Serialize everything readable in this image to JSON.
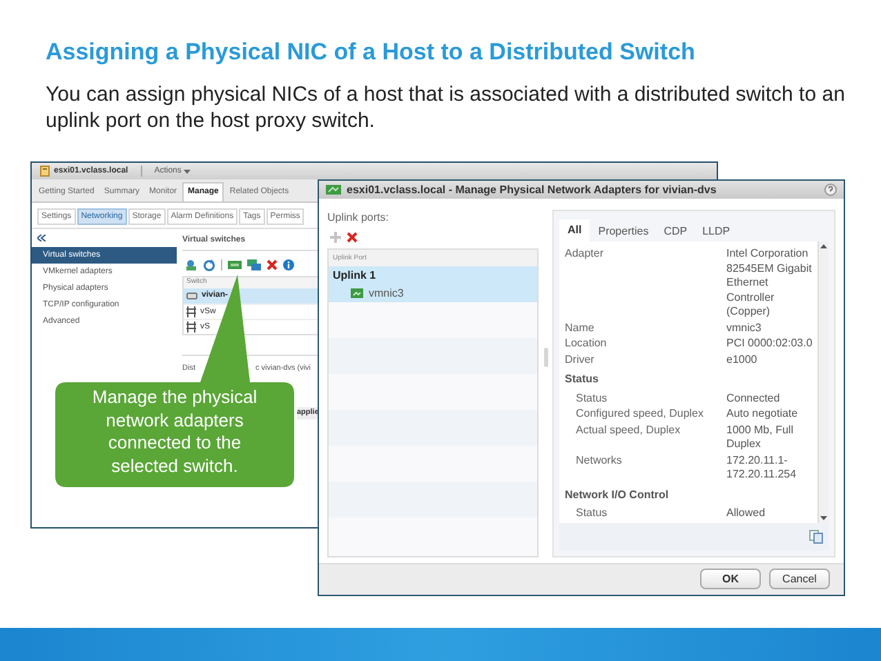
{
  "slide": {
    "title": "Assigning a Physical NIC of a Host to a Distributed Switch",
    "body": "You can assign physical NICs of a host that is associated with a distributed switch to an uplink port on the host proxy switch."
  },
  "host_window": {
    "title": "esxi01.vclass.local",
    "actions_menu": "Actions",
    "tabs": [
      {
        "label": "Getting Started",
        "selected": false
      },
      {
        "label": "Summary",
        "selected": false
      },
      {
        "label": "Monitor",
        "selected": false
      },
      {
        "label": "Manage",
        "selected": true
      },
      {
        "label": "Related Objects",
        "selected": false
      }
    ],
    "subtabs": [
      {
        "label": "Settings",
        "selected": false
      },
      {
        "label": "Networking",
        "selected": true
      },
      {
        "label": "Storage",
        "selected": false
      },
      {
        "label": "Alarm Definitions",
        "selected": false
      },
      {
        "label": "Tags",
        "selected": false
      },
      {
        "label": "Permiss",
        "selected": false
      }
    ],
    "nav_items": [
      {
        "label": "Virtual switches",
        "selected": true
      },
      {
        "label": "VMkernel adapters",
        "selected": false
      },
      {
        "label": "Physical adapters",
        "selected": false
      },
      {
        "label": "TCP/IP configuration",
        "selected": false
      },
      {
        "label": "Advanced",
        "selected": false
      }
    ],
    "switches": {
      "title": "Virtual switches",
      "column": "Switch",
      "rows": [
        {
          "name": "vivian-",
          "kind": "distributed",
          "selected": true
        },
        {
          "name": "vSw",
          "kind": "standard",
          "selected": false
        },
        {
          "name": "vS",
          "kind": "standard",
          "selected": false
        }
      ]
    },
    "details_label": [
      "Dist",
      "c vivian-dvs (vivi"
    ],
    "button_fragment": "applie"
  },
  "callout": {
    "text": "Manage the physical network adapters connected to the selected switch."
  },
  "dialog": {
    "title": "esxi01.vclass.local - Manage Physical Network Adapters for vivian-dvs",
    "uplinks_label": "Uplink ports:",
    "uplink_column": "Uplink Port",
    "uplinks": [
      {
        "name": "Uplink 1",
        "selected": true,
        "children": [
          {
            "name": "vmnic3",
            "selected": true
          }
        ]
      }
    ],
    "tabs": [
      {
        "label": "All",
        "selected": true
      },
      {
        "label": "Properties",
        "selected": false
      },
      {
        "label": "CDP",
        "selected": false
      },
      {
        "label": "LLDP",
        "selected": false
      }
    ],
    "properties": [
      {
        "kind": "row",
        "label": "Adapter",
        "value": "Intel Corporation 82545EM Gigabit Ethernet Controller (Copper)"
      },
      {
        "kind": "row",
        "label": "Name",
        "value": "vmnic3"
      },
      {
        "kind": "row",
        "label": "Location",
        "value": "PCI 0000:02:03.0"
      },
      {
        "kind": "row",
        "label": "Driver",
        "value": "e1000"
      },
      {
        "kind": "section",
        "label": "Status",
        "children": [
          {
            "label": "Status",
            "value": "Connected"
          },
          {
            "label": "Configured speed, Duplex",
            "value": "Auto negotiate"
          },
          {
            "label": "Actual speed, Duplex",
            "value": "1000 Mb, Full Duplex"
          },
          {
            "label": "Networks",
            "value": "172.20.11.1-172.20.11.254"
          }
        ]
      },
      {
        "kind": "section",
        "label": "Network I/O Control",
        "children": [
          {
            "label": "Status",
            "value": "Allowed"
          }
        ]
      }
    ],
    "buttons": [
      {
        "label": "OK",
        "default": true
      },
      {
        "label": "Cancel",
        "default": false
      }
    ]
  }
}
